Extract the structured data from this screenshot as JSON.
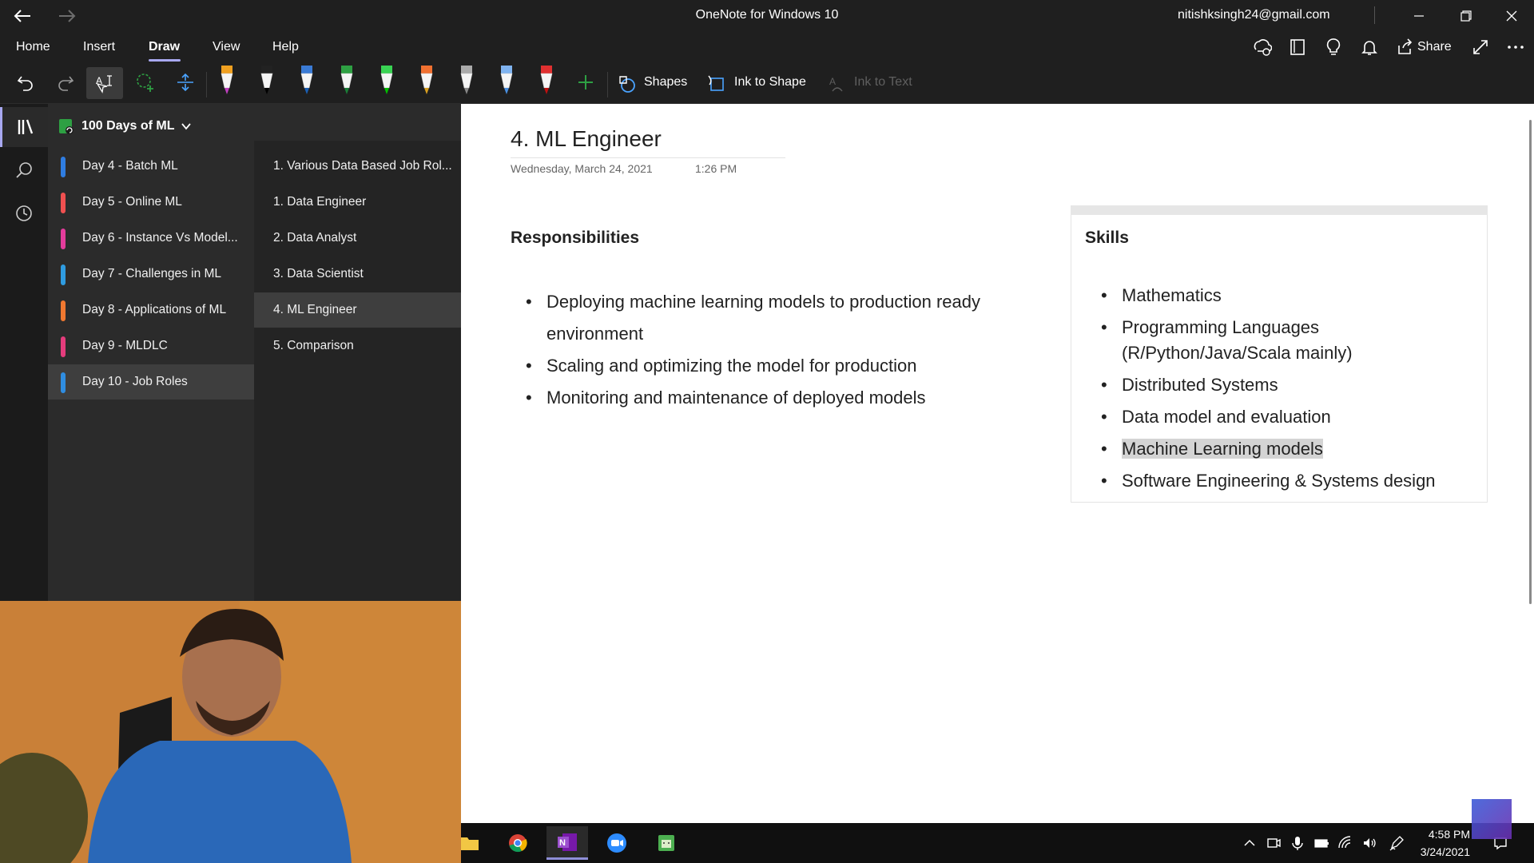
{
  "window": {
    "title": "OneNote for Windows 10",
    "account": "nitishksingh24@gmail.com"
  },
  "ribbon": {
    "tabs": [
      "Home",
      "Insert",
      "Draw",
      "View",
      "Help"
    ],
    "active_tab": "Draw",
    "share_label": "Share"
  },
  "toolbar": {
    "shapes_label": "Shapes",
    "ink_to_shape_label": "Ink to Shape",
    "ink_to_text_label": "Ink to Text",
    "pens": [
      {
        "name": "highlighter-pen",
        "color": "#f0a020",
        "tip": "#c040c0"
      },
      {
        "name": "black-pen",
        "color": "#222222",
        "tip": "#000000"
      },
      {
        "name": "blue-pen",
        "color": "#3a7bd5",
        "tip": "#1a5fb4"
      },
      {
        "name": "green-pen",
        "color": "#2ea043",
        "tip": "#1a7f37"
      },
      {
        "name": "green-highlighter",
        "color": "#39d353",
        "tip": "#00c000"
      },
      {
        "name": "orange-pen",
        "color": "#f07030",
        "tip": "#d9a020"
      },
      {
        "name": "grey-pen",
        "color": "#aaaaaa",
        "tip": "#888888"
      },
      {
        "name": "lightblue-pen",
        "color": "#7fb3f0",
        "tip": "#4a90e2"
      },
      {
        "name": "red-pen",
        "color": "#e03030",
        "tip": "#c01010"
      }
    ]
  },
  "notebook": {
    "name": "100 Days of ML"
  },
  "sections": [
    {
      "label": "Day 4 - Batch ML",
      "color": "#2f7de1"
    },
    {
      "label": "Day 5 - Online ML",
      "color": "#f05050"
    },
    {
      "label": "Day 6 - Instance Vs Model...",
      "color": "#e43c9c"
    },
    {
      "label": "Day 7 - Challenges in ML",
      "color": "#2f9ce1"
    },
    {
      "label": "Day 8 - Applications of ML",
      "color": "#f07830"
    },
    {
      "label": "Day 9 - MLDLC",
      "color": "#e43c7c"
    },
    {
      "label": "Day 10 - Job Roles",
      "color": "#2f8de1"
    }
  ],
  "pages": [
    "1. Various Data Based Job Rol...",
    "1. Data Engineer",
    "2. Data Analyst",
    "3. Data Scientist",
    "4. ML Engineer",
    "5. Comparison"
  ],
  "page": {
    "title": "4. ML Engineer",
    "date": "Wednesday, March 24, 2021",
    "time": "1:26 PM",
    "responsibilities_heading": "Responsibilities",
    "responsibilities": [
      "Deploying machine learning models to production ready environment",
      "Scaling and optimizing the model for production",
      "Monitoring and maintenance of deployed models"
    ],
    "skills_heading": "Skills",
    "skills": [
      "Mathematics",
      "Programming Languages (R/Python/Java/Scala mainly)",
      "Distributed Systems",
      "Data model and evaluation",
      "Machine Learning models",
      "Software Engineering & Systems design"
    ]
  },
  "taskbar": {
    "time": "4:58 PM",
    "date": "3/24/2021"
  }
}
